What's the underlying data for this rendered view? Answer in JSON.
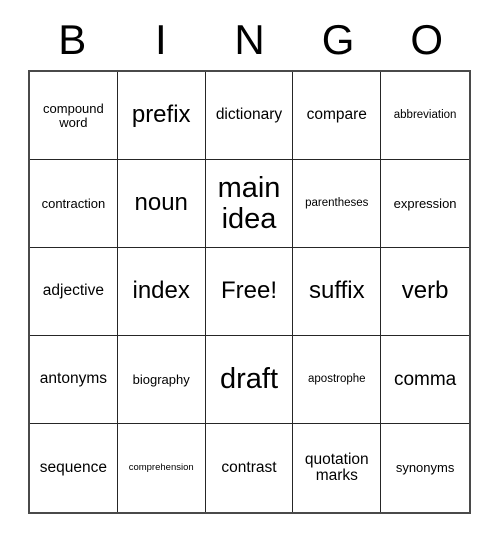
{
  "card": {
    "title_letters": [
      "B",
      "I",
      "N",
      "G",
      "O"
    ],
    "grid_size": 5,
    "free_space_label": "Free!",
    "colors": {
      "text": "#000000",
      "background": "#ffffff",
      "grid_line": "#262626",
      "outer_border": "#4a4a4a"
    },
    "cells": [
      {
        "text": "compound word",
        "size": "fs-s"
      },
      {
        "text": "prefix",
        "size": "fs-xl"
      },
      {
        "text": "dictionary",
        "size": "fs-m"
      },
      {
        "text": "compare",
        "size": "fs-m"
      },
      {
        "text": "abbreviation",
        "size": "fs-xs"
      },
      {
        "text": "contraction",
        "size": "fs-s"
      },
      {
        "text": "noun",
        "size": "fs-xl"
      },
      {
        "text": "main idea",
        "size": "fs-xxl"
      },
      {
        "text": "parentheses",
        "size": "fs-xs"
      },
      {
        "text": "expression",
        "size": "fs-s"
      },
      {
        "text": "adjective",
        "size": "fs-m"
      },
      {
        "text": "index",
        "size": "fs-xl"
      },
      {
        "text": "Free!",
        "size": "fs-xl"
      },
      {
        "text": "suffix",
        "size": "fs-xl"
      },
      {
        "text": "verb",
        "size": "fs-xl"
      },
      {
        "text": "antonyms",
        "size": "fs-m"
      },
      {
        "text": "biography",
        "size": "fs-s"
      },
      {
        "text": "draft",
        "size": "fs-xxl"
      },
      {
        "text": "apostrophe",
        "size": "fs-xs"
      },
      {
        "text": "comma",
        "size": "fs-l"
      },
      {
        "text": "sequence",
        "size": "fs-m"
      },
      {
        "text": "comprehension",
        "size": "fs-xxs"
      },
      {
        "text": "contrast",
        "size": "fs-m"
      },
      {
        "text": "quotation marks",
        "size": "fs-m"
      },
      {
        "text": "synonyms",
        "size": "fs-s"
      }
    ]
  }
}
